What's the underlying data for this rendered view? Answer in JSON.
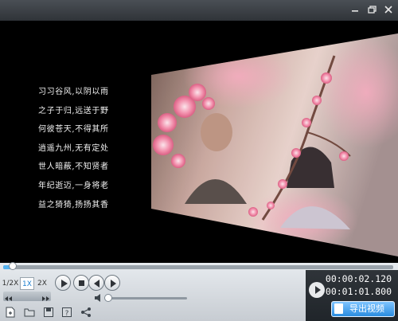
{
  "window": {
    "minimize_icon": "minimize-icon",
    "restore_icon": "restore-icon",
    "close_icon": "close-icon"
  },
  "poem": {
    "lines": [
      "习习谷风,以阴以雨",
      "之子于归,远送于野",
      "何彼苍天,不得其所",
      "逍遥九州,无有定处",
      "世人暗蔽,不知贤者",
      "年纪逝迈,一身将老",
      "益之猗猗,扬扬其香"
    ]
  },
  "playback": {
    "progress_fraction": 0.025,
    "volume_fraction": 0.0,
    "speeds": [
      "1/2X",
      "1X",
      "2X"
    ],
    "active_speed": "1X"
  },
  "timer": {
    "current": "00:00:02.120",
    "total": "00:01:01.800"
  },
  "export": {
    "label": "导出视频"
  },
  "toolbar": {
    "icons": [
      "new-project-icon",
      "open-folder-icon",
      "save-icon",
      "help-icon",
      "share-icon"
    ]
  },
  "colors": {
    "accent": "#56b3f0",
    "export_button": "#2a8ce0",
    "stage_background": "#000000"
  }
}
